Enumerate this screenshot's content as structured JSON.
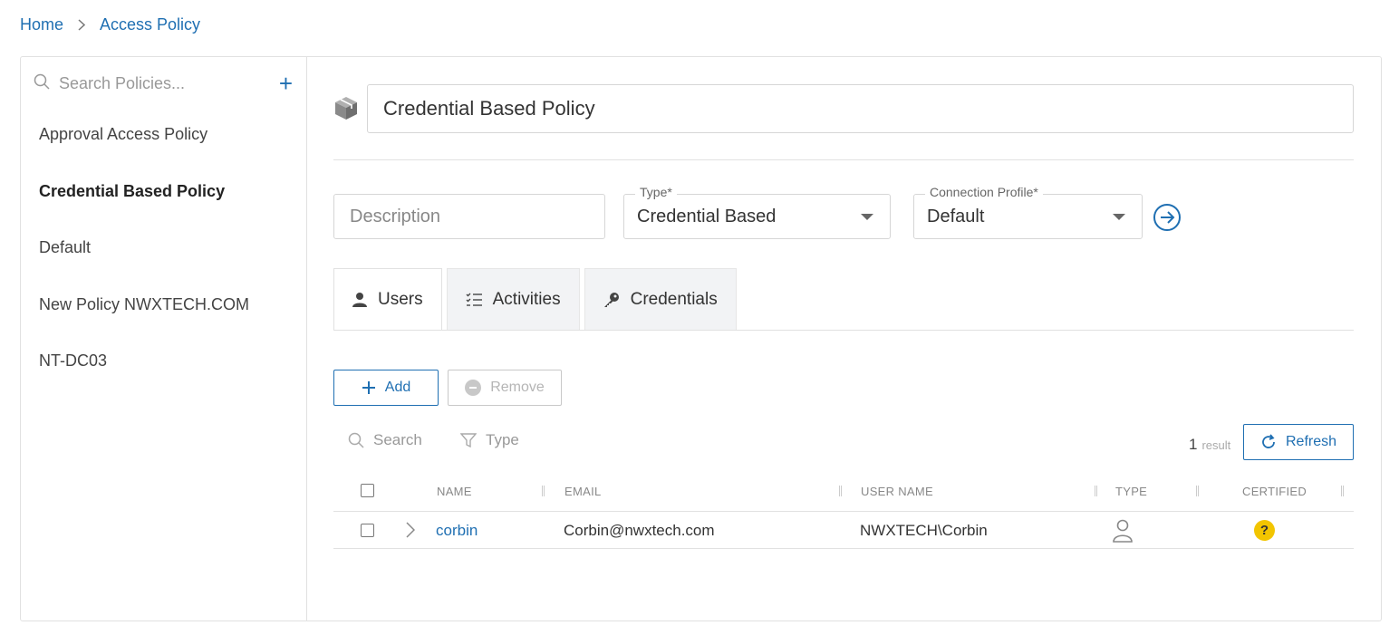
{
  "breadcrumb": {
    "home": "Home",
    "current": "Access Policy"
  },
  "sidebar": {
    "search_placeholder": "Search Policies...",
    "add_label": "+",
    "items": [
      {
        "label": "Approval Access Policy",
        "active": false
      },
      {
        "label": "Credential Based Policy",
        "active": true
      },
      {
        "label": "Default",
        "active": false
      },
      {
        "label": "New Policy NWXTECH.COM",
        "active": false
      },
      {
        "label": "NT-DC03",
        "active": false
      }
    ]
  },
  "policy": {
    "name": "Credential Based Policy",
    "description_placeholder": "Description",
    "type_label": "Type*",
    "type_value": "Credential Based",
    "connection_label": "Connection Profile*",
    "connection_value": "Default"
  },
  "tabs": [
    {
      "label": "Users",
      "icon": "user-icon",
      "active": true
    },
    {
      "label": "Activities",
      "icon": "checklist-icon",
      "active": false
    },
    {
      "label": "Credentials",
      "icon": "key-icon",
      "active": false
    }
  ],
  "toolbar": {
    "add_label": "Add",
    "remove_label": "Remove",
    "refresh_label": "Refresh"
  },
  "filters": {
    "search_label": "Search",
    "type_label": "Type"
  },
  "results": {
    "count": "1",
    "label": "result"
  },
  "table": {
    "columns": [
      "NAME",
      "EMAIL",
      "USER NAME",
      "TYPE",
      "CERTIFIED"
    ],
    "rows": [
      {
        "name": "corbin",
        "email": "Corbin@nwxtech.com",
        "username": "NWXTECH\\Corbin",
        "type_icon": "user-outline-icon",
        "certified": "?"
      }
    ]
  },
  "colors": {
    "accent": "#1f6fb2",
    "badge": "#f2c500"
  }
}
